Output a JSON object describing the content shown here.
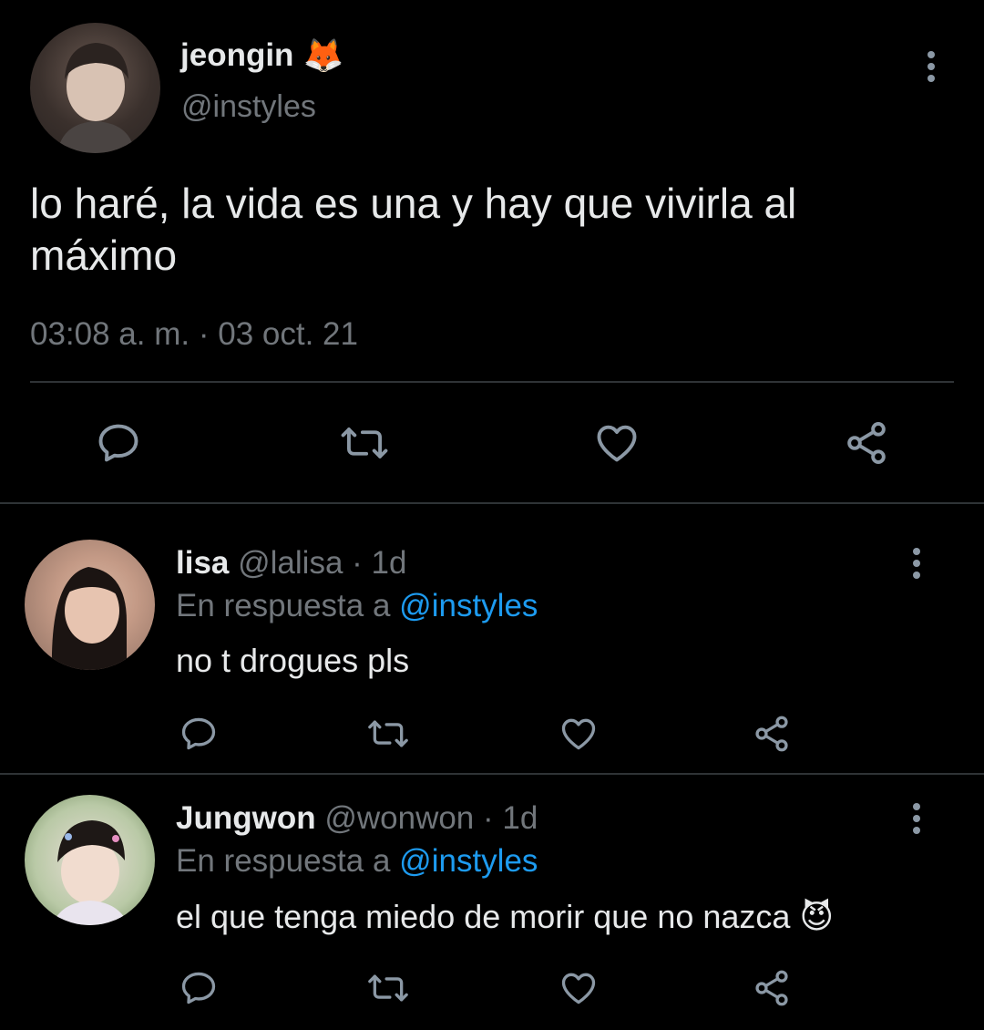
{
  "main_tweet": {
    "name": "jeongin",
    "emoji": "🦊",
    "handle": "@instyles",
    "text": "lo haré, la vida es una y hay que vivirla al máximo",
    "time": "03:08 a. m.",
    "separator": "·",
    "date": "03 oct. 21"
  },
  "replies": [
    {
      "name": "lisa",
      "handle": "@lalisa",
      "age": "· 1d",
      "reply_prefix": "En respuesta a",
      "reply_to": "@instyles",
      "text": "no t drogues pls",
      "emoji": ""
    },
    {
      "name": "Jungwon",
      "handle": "@wonwon",
      "age": "· 1d",
      "reply_prefix": "En respuesta a",
      "reply_to": "@instyles",
      "text": "el que tenga miedo de morir que no nazca",
      "emoji": "😈"
    }
  ],
  "icons": {
    "reply": "speech-bubble-icon",
    "retweet": "retweet-icon",
    "like": "heart-icon",
    "share": "share-icon",
    "more": "more-vertical-icon"
  },
  "colors": {
    "background": "#000000",
    "text": "#e7e9ea",
    "muted": "#71767b",
    "link": "#1d9bf0",
    "icon": "#8b98a5"
  }
}
